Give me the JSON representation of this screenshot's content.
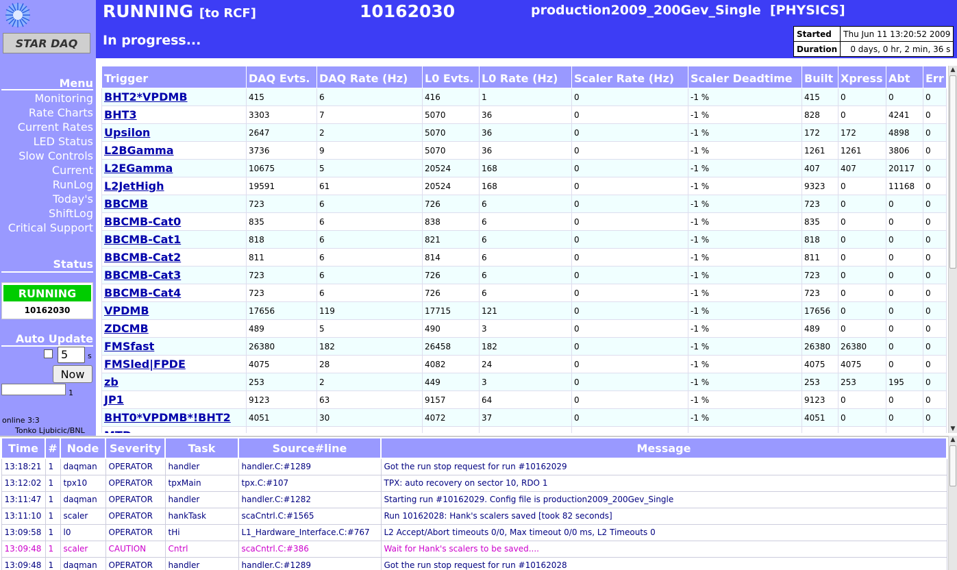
{
  "sidebar": {
    "logo_text": "STAR DAQ",
    "menu_heading": "Menu",
    "menu_items": [
      "Monitoring",
      "Rate Charts",
      "Current Rates",
      "LED Status",
      "Slow Controls",
      "Current",
      "RunLog",
      "Today's",
      "ShiftLog",
      "Critical Support"
    ],
    "status_heading": "Status",
    "status_state": "RUNNING",
    "status_run": "10162030",
    "status_color": "#00cc00",
    "auto_update_heading": "Auto Update",
    "auto_update_value": "5",
    "auto_update_unit": "s",
    "now_label": "Now",
    "progress_count": "1",
    "online_text": "online 3:3",
    "author_text": "Tonko Ljubicic/BNL"
  },
  "header": {
    "state": "RUNNING",
    "destination": "[to RCF]",
    "run_number": "10162030",
    "config": "production2009_200Gev_Single",
    "run_type": "[PHYSICS]",
    "progress_text": "In progress...",
    "started_label": "Started",
    "started_value": "Thu Jun 11 13:20:52 2009",
    "duration_label": "Duration",
    "duration_value": "0 days, 0 hr, 2 min, 36 s",
    "bg_color": "#3d3df5"
  },
  "triggers": {
    "columns": [
      "Trigger",
      "DAQ Evts.",
      "DAQ Rate (Hz)",
      "L0 Evts.",
      "L0 Rate (Hz)",
      "Scaler Rate (Hz)",
      "Scaler Deadtime",
      "Built",
      "Xpress",
      "Abt",
      "Err"
    ],
    "rows": [
      [
        "BHT2*VPDMB",
        "415",
        "6",
        "416",
        "1",
        "0",
        "-1 %",
        "415",
        "0",
        "0",
        "0"
      ],
      [
        "BHT3",
        "3303",
        "7",
        "5070",
        "36",
        "0",
        "-1 %",
        "828",
        "0",
        "4241",
        "0"
      ],
      [
        "Upsilon",
        "2647",
        "2",
        "5070",
        "36",
        "0",
        "-1 %",
        "172",
        "172",
        "4898",
        "0"
      ],
      [
        "L2BGamma",
        "3736",
        "9",
        "5070",
        "36",
        "0",
        "-1 %",
        "1261",
        "1261",
        "3806",
        "0"
      ],
      [
        "L2EGamma",
        "10675",
        "5",
        "20524",
        "168",
        "0",
        "-1 %",
        "407",
        "407",
        "20117",
        "0"
      ],
      [
        "L2JetHigh",
        "19591",
        "61",
        "20524",
        "168",
        "0",
        "-1 %",
        "9323",
        "0",
        "11168",
        "0"
      ],
      [
        "BBCMB",
        "723",
        "6",
        "726",
        "6",
        "0",
        "-1 %",
        "723",
        "0",
        "0",
        "0"
      ],
      [
        "BBCMB-Cat0",
        "835",
        "6",
        "838",
        "6",
        "0",
        "-1 %",
        "835",
        "0",
        "0",
        "0"
      ],
      [
        "BBCMB-Cat1",
        "818",
        "6",
        "821",
        "6",
        "0",
        "-1 %",
        "818",
        "0",
        "0",
        "0"
      ],
      [
        "BBCMB-Cat2",
        "811",
        "6",
        "814",
        "6",
        "0",
        "-1 %",
        "811",
        "0",
        "0",
        "0"
      ],
      [
        "BBCMB-Cat3",
        "723",
        "6",
        "726",
        "6",
        "0",
        "-1 %",
        "723",
        "0",
        "0",
        "0"
      ],
      [
        "BBCMB-Cat4",
        "723",
        "6",
        "726",
        "6",
        "0",
        "-1 %",
        "723",
        "0",
        "0",
        "0"
      ],
      [
        "VPDMB",
        "17656",
        "119",
        "17715",
        "121",
        "0",
        "-1 %",
        "17656",
        "0",
        "0",
        "0"
      ],
      [
        "ZDCMB",
        "489",
        "5",
        "490",
        "3",
        "0",
        "-1 %",
        "489",
        "0",
        "0",
        "0"
      ],
      [
        "FMSfast",
        "26380",
        "182",
        "26458",
        "182",
        "0",
        "-1 %",
        "26380",
        "26380",
        "0",
        "0"
      ],
      [
        "FMSled|FPDE",
        "4075",
        "28",
        "4082",
        "24",
        "0",
        "-1 %",
        "4075",
        "4075",
        "0",
        "0"
      ],
      [
        "zb",
        "253",
        "2",
        "449",
        "3",
        "0",
        "-1 %",
        "253",
        "253",
        "195",
        "0"
      ],
      [
        "JP1",
        "9123",
        "63",
        "9157",
        "64",
        "0",
        "-1 %",
        "9123",
        "0",
        "0",
        "0"
      ],
      [
        "BHT0*VPDMB*!BHT2",
        "4051",
        "30",
        "4072",
        "37",
        "0",
        "-1 %",
        "4051",
        "0",
        "0",
        "0"
      ],
      [
        "MTD",
        "",
        "",
        "",
        "",
        "",
        "",
        "",
        "",
        "",
        ""
      ]
    ]
  },
  "log": {
    "columns": [
      "Time",
      "#",
      "Node",
      "Severity",
      "Task",
      "Source#line",
      "Message"
    ],
    "rows": [
      [
        "13:18:21",
        "1",
        "daqman",
        "OPERATOR",
        "handler",
        "handler.C:#1289",
        "Got the run stop request for run #10162029"
      ],
      [
        "13:12:02",
        "1",
        "tpx10",
        "OPERATOR",
        "tpxMain",
        "tpx.C:#107",
        "TPX: auto recovery on sector 10, RDO 1"
      ],
      [
        "13:11:47",
        "1",
        "daqman",
        "OPERATOR",
        "handler",
        "handler.C:#1282",
        "Starting run #10162029. Config file is production2009_200Gev_Single"
      ],
      [
        "13:11:10",
        "1",
        "scaler",
        "OPERATOR",
        "hankTask",
        "scaCntrl.C:#1565",
        "Run 10162028: Hank's scalers saved [took 82 seconds]"
      ],
      [
        "13:09:58",
        "1",
        "l0",
        "OPERATOR",
        "tHi",
        "L1_Hardware_Interface.C:#767",
        "L2 Accept/Abort timeouts 0/0, Max timeout 0/0 ms, L2 Timeouts 0"
      ],
      [
        "13:09:48",
        "1",
        "scaler",
        "CAUTION",
        "Cntrl",
        "scaCntrl.C:#386",
        "Wait for Hank's scalers to be saved...."
      ],
      [
        "13:09:48",
        "1",
        "daqman",
        "OPERATOR",
        "handler",
        "handler.C:#1289",
        "Got the run stop request for run #10162028"
      ]
    ],
    "caution_color": "#cc00cc"
  }
}
